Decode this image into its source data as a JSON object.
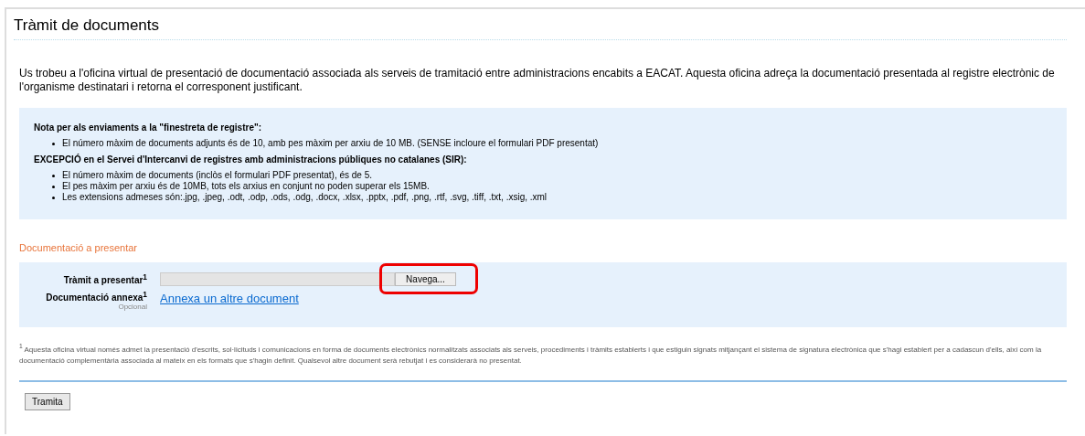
{
  "title": "Tràmit de documents",
  "intro": "Us trobeu a l'oficina virtual de presentació de documentació associada als serveis de tramitació entre administracions encabits a EACAT. Aquesta oficina adreça la documentació presentada al registre electrònic de l'organisme destinatari i retorna el corresponent justificant.",
  "notice": {
    "sections": [
      {
        "heading": "Nota per als enviaments a la \"finestreta de registre\":",
        "items": [
          "El número màxim de documents adjunts és de 10, amb pes màxim per arxiu de 10 MB. (SENSE incloure el formulari PDF presentat)"
        ]
      },
      {
        "heading": "EXCEPCIÓ en el Servei d'Intercanvi de registres amb administracions públiques no catalanes (SIR):",
        "items": [
          "El número màxim de documents (inclòs el formulari PDF presentat), és de 5.",
          "El pes màxim per arxiu és de 10MB, tots els arxius en conjunt no poden superar els 15MB.",
          "Les extensions admeses són:.jpg, .jpeg, .odt, .odp, .ods, .odg, .docx, .xlsx, .pptx, .pdf, .png, .rtf, .svg, .tiff, .txt, .xsig, .xml"
        ]
      }
    ]
  },
  "section_heading": "Documentació a presentar",
  "form": {
    "rows": [
      {
        "kind": "file",
        "label": "Tràmit a presentar$^{1}$",
        "button": "Navega...",
        "highlighted": true
      },
      {
        "kind": "link",
        "label": "Documentació annexa$^{1}$",
        "sublabel": "Opcional",
        "link": "Annexa un altre document"
      }
    ]
  },
  "footnote": "$^{1}$ Aquesta oficina virtual només admet la presentació d'escrits, sol·licituds i comunicacions en forma de documents electrònics normalitzats associats als serveis, procediments i tràmits establerts i que estiguin signats mitjançant el sistema de signatura electrònica que s'hagi establert per a cadascun d'ells, així com la documentació complementària associada al mateix en els formats que s'hagin definit. Qualsevol altre document serà rebutjat i es considerarà no presentat.",
  "submit": "Tramita"
}
